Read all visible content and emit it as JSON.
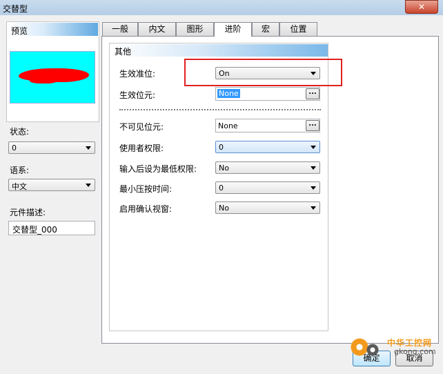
{
  "window": {
    "title": "交替型",
    "close_glyph": "✕"
  },
  "left": {
    "preview_label": "预览",
    "state_label": "状态:",
    "state_value": "0",
    "language_label": "语系:",
    "language_value": "中文",
    "description_label": "元件描述:",
    "description_value": "交替型_000"
  },
  "tabs": [
    {
      "label": "一般",
      "active": false
    },
    {
      "label": "内文",
      "active": false
    },
    {
      "label": "图形",
      "active": false
    },
    {
      "label": "进阶",
      "active": true
    },
    {
      "label": "宏",
      "active": false
    },
    {
      "label": "位置",
      "active": false
    }
  ],
  "advanced": {
    "section_title": "其他",
    "effective_level_label": "生效准位:",
    "effective_level_value": "On",
    "effective_bit_label": "生效位元:",
    "effective_bit_value": "None",
    "invisible_bit_label": "不可见位元:",
    "invisible_bit_value": "None",
    "user_permission_label": "使用者权限:",
    "user_permission_value": "0",
    "set_lowest_label": "输入后设为最低权限:",
    "set_lowest_value": "No",
    "min_press_label": "最小压按时间:",
    "min_press_value": "0",
    "confirm_label": "启用确认视窗:",
    "confirm_value": "No",
    "browse_label": "..."
  },
  "buttons": {
    "ok": "确定",
    "cancel": "取消"
  },
  "watermark": {
    "text_cn": "中华工控网",
    "url": "gkong.com"
  },
  "colors": {
    "highlight": "#e02020",
    "preview_bg": "#00ffff",
    "preview_shape": "#ff0000"
  }
}
